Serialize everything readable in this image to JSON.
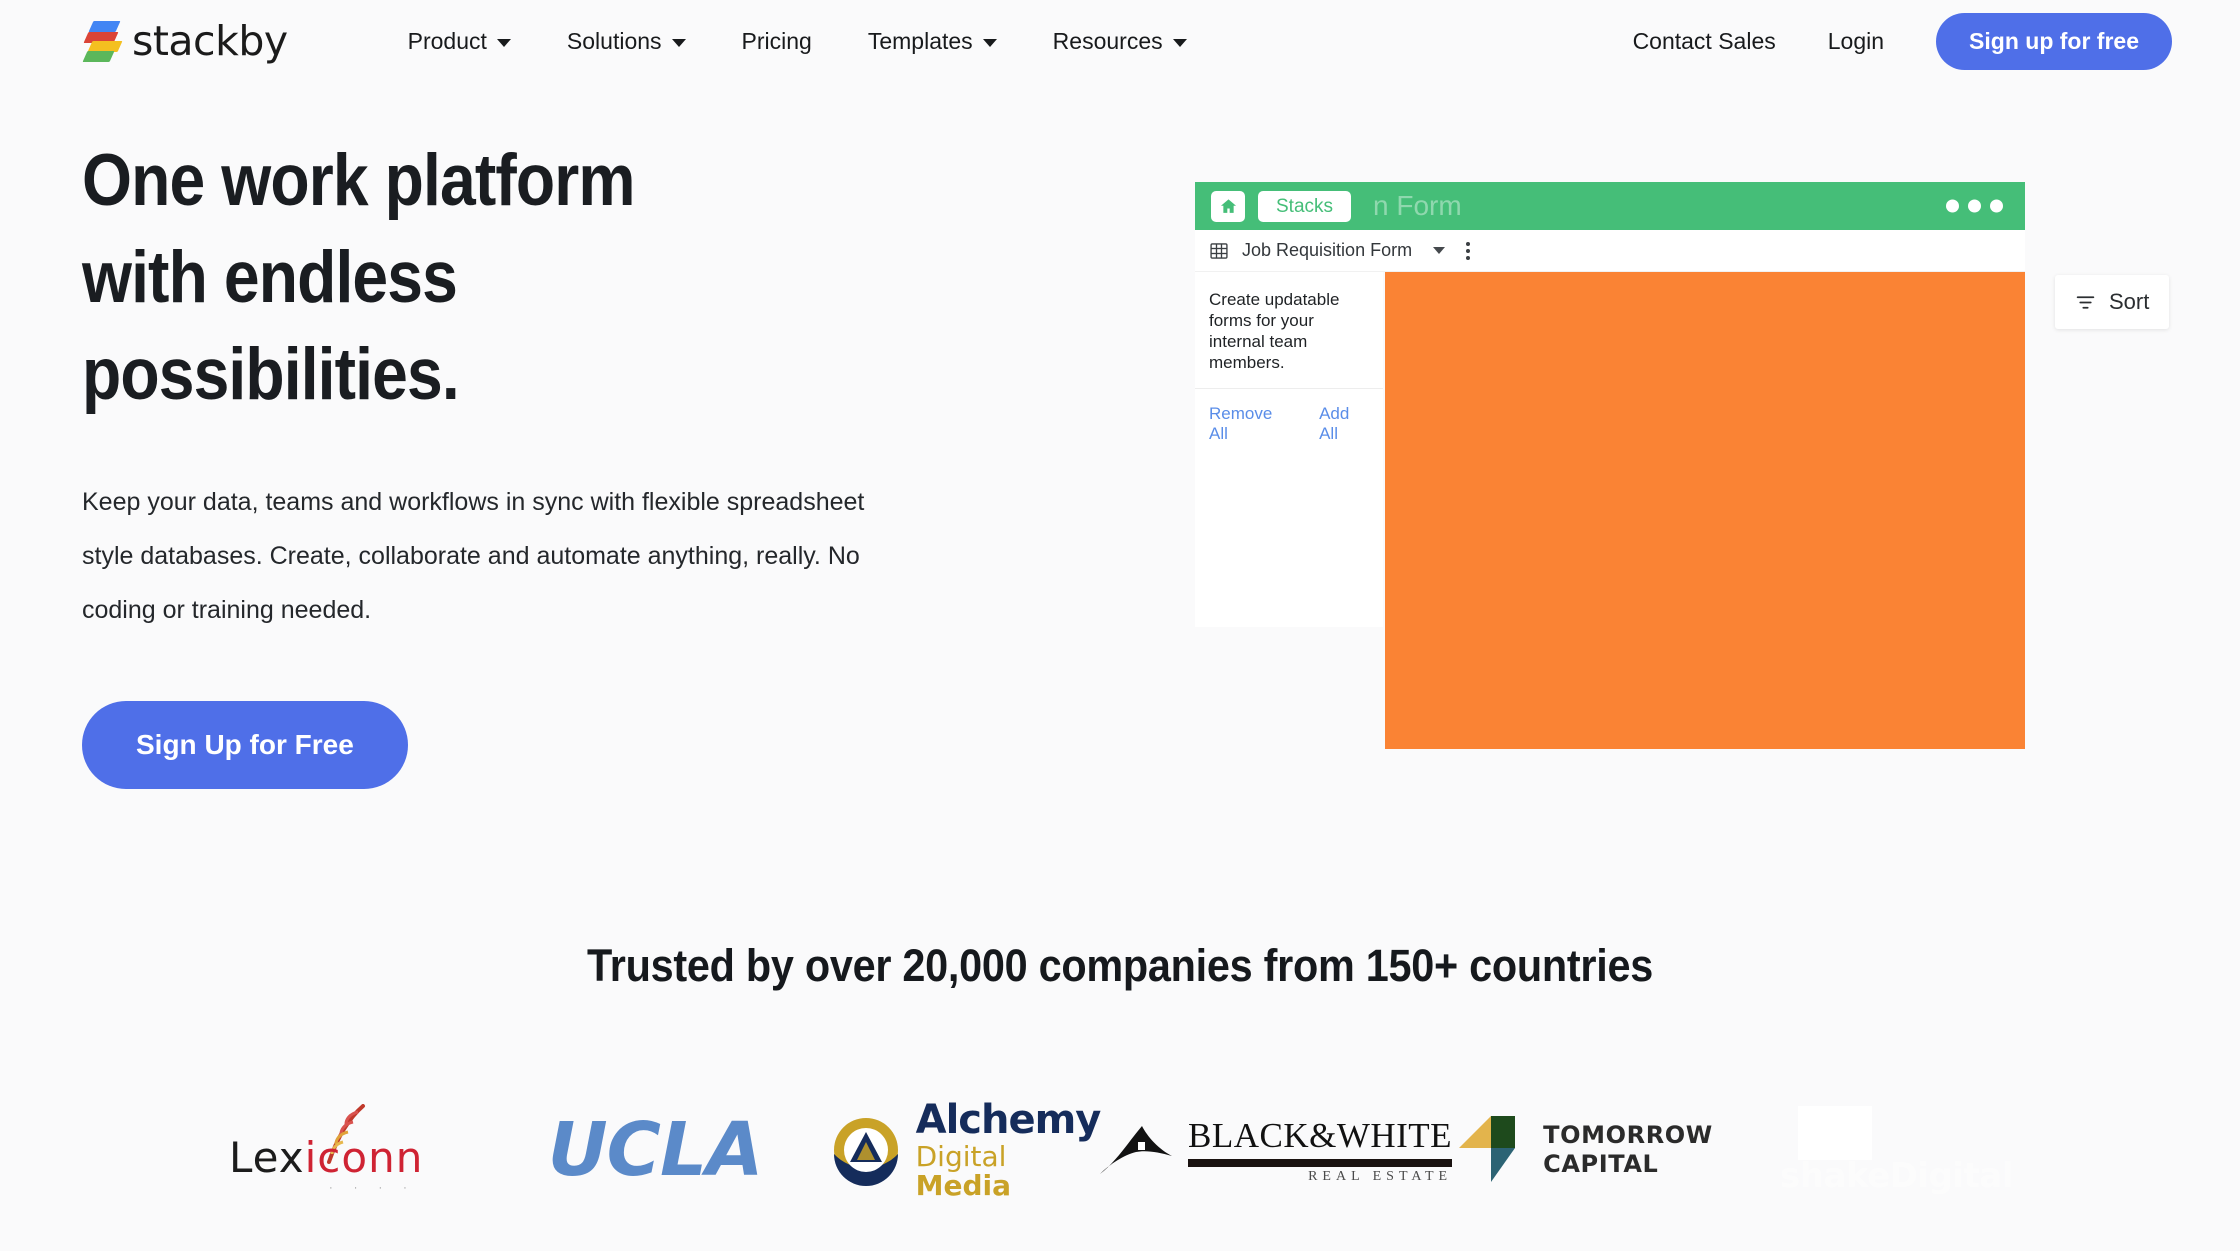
{
  "brand": {
    "name": "stackby",
    "logo_colors": [
      "#4285F4",
      "#DB4437",
      "#F4C020",
      "#5BB75B"
    ]
  },
  "nav": {
    "items": [
      {
        "label": "Product",
        "has_dropdown": true,
        "icon": "chevron-down-icon"
      },
      {
        "label": "Solutions",
        "has_dropdown": true,
        "icon": "chevron-down-icon"
      },
      {
        "label": "Pricing",
        "has_dropdown": false,
        "icon": ""
      },
      {
        "label": "Templates",
        "has_dropdown": true,
        "icon": "chevron-down-icon"
      },
      {
        "label": "Resources",
        "has_dropdown": true,
        "icon": "chevron-down-icon"
      }
    ],
    "contact_sales": "Contact Sales",
    "login": "Login",
    "signup": "Sign up for free",
    "signup_color": "#4F6FE8"
  },
  "hero": {
    "title_line1": "One work platform",
    "title_line2": "with endless",
    "title_line3": "possibilities.",
    "subtitle": "Keep your data, teams and workflows in sync with flexible spreadsheet style databases. Create, collaborate and automate anything, really. No coding or training needed.",
    "cta_label": "Sign Up for Free",
    "cta_color": "#4F6FE8"
  },
  "mockup": {
    "topbar_color": "#45BE78",
    "home_icon": "home-icon",
    "stacks_badge": "Stacks",
    "faded_title": "n Form",
    "window_dots": 3,
    "toolbar": {
      "grid_icon": "grid-icon",
      "view_name": "Job Requisition Form",
      "caret_icon": "chevron-down-icon",
      "kebab_icon": "more-vertical-icon"
    },
    "panel": {
      "description": "Create updatable forms for your internal team members.",
      "remove_all": "Remove All",
      "add_all": "Add All",
      "link_color": "#5A8DE8"
    },
    "content_color": "#FA8334"
  },
  "sort_chip": {
    "label": "Sort",
    "icon": "sort-icon"
  },
  "trusted": {
    "heading": "Trusted by over 20,000 companies from 150+ countries",
    "logos": [
      {
        "name": "lexiconn",
        "text_a": "Le",
        "text_b": "iconn",
        "text_mid": "x"
      },
      {
        "name": "ucla",
        "text": "UCLA"
      },
      {
        "name": "alchemy-digital-media",
        "line1": "Alchemy",
        "line2_a": "Digital ",
        "line2_b": "Media"
      },
      {
        "name": "black-and-white-real-estate",
        "line1": "BLACK&WHITE",
        "line2": "REAL ESTATE"
      },
      {
        "name": "tomorrow-capital",
        "line1": "TOMORROW",
        "line2": "CAPITAL"
      },
      {
        "name": "shake-digital",
        "text": "shakeDigital"
      }
    ]
  }
}
